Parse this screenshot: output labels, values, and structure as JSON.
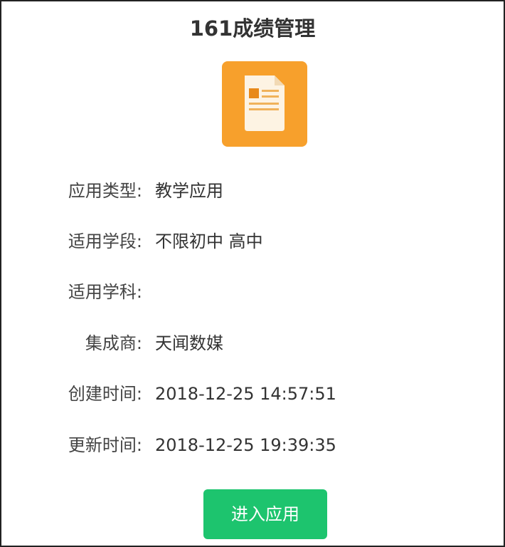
{
  "app": {
    "title": "161成绩管理",
    "icon": "document-icon",
    "icon_color": "#f7a02c"
  },
  "details": [
    {
      "label": "应用类型:",
      "value": "教学应用"
    },
    {
      "label": "适用学段:",
      "value": "不限初中 高中"
    },
    {
      "label": "适用学科:",
      "value": ""
    },
    {
      "label": "集成商:",
      "value": "天闻数媒"
    },
    {
      "label": "创建时间:",
      "value": "2018-12-25 14:57:51"
    },
    {
      "label": "更新时间:",
      "value": "2018-12-25 19:39:35"
    }
  ],
  "actions": {
    "enter_label": "进入应用",
    "enter_color": "#1dc46e"
  }
}
